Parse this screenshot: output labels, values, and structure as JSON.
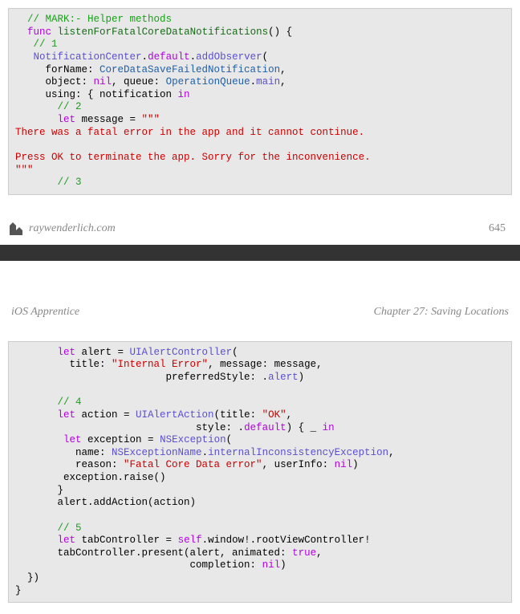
{
  "footer": {
    "site": "raywenderlich.com",
    "page": "645"
  },
  "header": {
    "book": "iOS Apprentice",
    "chapter": "Chapter 27: Saving Locations"
  },
  "code1": {
    "l1": "// MARK:- Helper methods",
    "l2a": "func",
    "l2b": "listenForFatalCoreDataNotifications",
    "l2c": "() {",
    "l3": "// 1",
    "l4a": "NotificationCenter",
    "l4b": ".",
    "l4c": "default",
    "l4d": ".",
    "l4e": "addObserver",
    "l4f": "(",
    "l5a": "forName: ",
    "l5b": "CoreDataSaveFailedNotification",
    "l5c": ",",
    "l6a": "object: ",
    "l6b": "nil",
    "l6c": ", queue: ",
    "l6d": "OperationQueue",
    "l6e": ".",
    "l6f": "main",
    "l6g": ",",
    "l7a": "using: { notification ",
    "l7b": "in",
    "l8": "// 2",
    "l9a": "let",
    "l9b": " message = ",
    "l9c": "\"\"\"",
    "l10": "There was a fatal error in the app and it cannot continue.",
    "l11": "",
    "l12": "Press OK to terminate the app. Sorry for the inconvenience.",
    "l13": "\"\"\"",
    "l14": "// 3"
  },
  "code2": {
    "l1a": "let",
    "l1b": " alert = ",
    "l1c": "UIAlertController",
    "l1d": "(",
    "l2a": "title: ",
    "l2b": "\"Internal Error\"",
    "l2c": ", message: message,",
    "l3a": "preferredStyle: .",
    "l3b": "alert",
    "l3c": ")",
    "l4": "",
    "l5": "// 4",
    "l6a": "let",
    "l6b": " action = ",
    "l6c": "UIAlertAction",
    "l6d": "(title: ",
    "l6e": "\"OK\"",
    "l6f": ",",
    "l7a": "style: .",
    "l7b": "default",
    "l7c": ") { _ ",
    "l7d": "in",
    "l8a": "let",
    "l8b": " exception = ",
    "l8c": "NSException",
    "l8d": "(",
    "l9a": "name: ",
    "l9b": "NSExceptionName",
    "l9c": ".",
    "l9d": "internalInconsistencyException",
    "l9e": ",",
    "l10a": "reason: ",
    "l10b": "\"Fatal Core Data error\"",
    "l10c": ", userInfo: ",
    "l10d": "nil",
    "l10e": ")",
    "l11": "exception.raise()",
    "l12": "}",
    "l13": "alert.addAction(action)",
    "l14": "",
    "l15": "// 5",
    "l16a": "let",
    "l16b": " tabController = ",
    "l16c": "self",
    "l16d": ".window!.rootViewController!",
    "l17a": "tabController.present(alert, animated: ",
    "l17b": "true",
    "l17c": ",",
    "l18a": "completion: ",
    "l18b": "nil",
    "l18c": ")",
    "l19": "})",
    "l20": "}"
  }
}
